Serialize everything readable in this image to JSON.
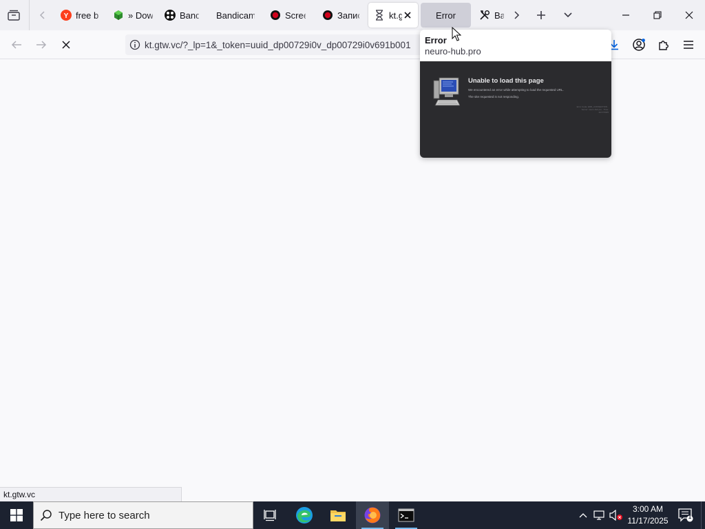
{
  "tabs": [
    {
      "label": "free b",
      "icon": "yandex-icon"
    },
    {
      "label": "» Dow",
      "icon": "green-cube-icon"
    },
    {
      "label": "Bandi",
      "icon": "bandicam-icon"
    },
    {
      "label": "Bandicam",
      "icon": "none"
    },
    {
      "label": "Scree",
      "icon": "record-icon"
    },
    {
      "label": "Запис",
      "icon": "record-icon"
    },
    {
      "label": "kt.g",
      "icon": "hourglass-icon"
    },
    {
      "label": "Error",
      "icon": "none"
    },
    {
      "label": "Bar",
      "icon": "tools-icon"
    }
  ],
  "navbar": {
    "url": "kt.gtw.vc/?_lp=1&_token=uuid_dp00729i0v_dp00729i0v691b001"
  },
  "tab_preview": {
    "title": "Error",
    "host": "neuro-hub.pro",
    "thumb_heading": "Unable to load this page",
    "thumb_line1": "We encountered an error while attempting to load the requested URL.",
    "thumb_line2": "The site requested is not responding.",
    "thumb_meta": "Error Code: ERR_CONNECTION · Server: neuro-hub.pro · Time: 11/17/2025"
  },
  "status_url": "kt.gtw.vc",
  "taskbar": {
    "search_placeholder": "Type here to search",
    "time": "3:00 AM",
    "date": "11/17/2025",
    "notification_count": "1"
  },
  "colors": {
    "tabstrip": "#f0f0f4",
    "taskbar": "#1c2230",
    "accent": "#0078d4",
    "record_red": "#d0021b"
  }
}
